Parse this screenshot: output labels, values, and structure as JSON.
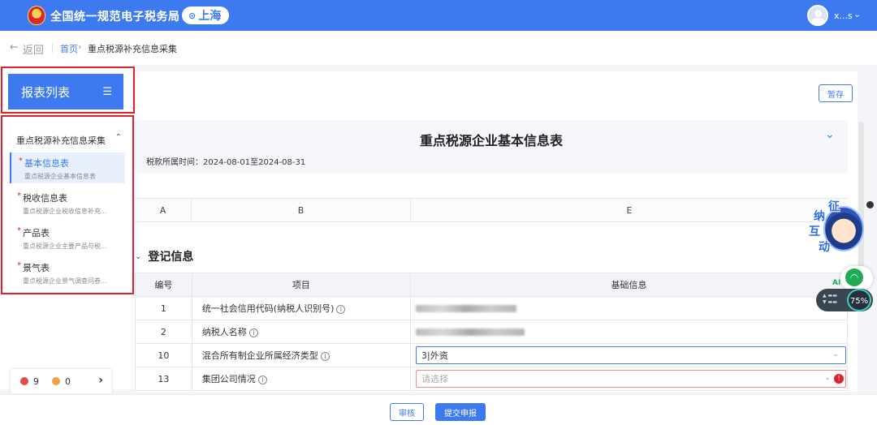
{
  "header": {
    "brand": "全国统一规范电子税务局",
    "location": "上海",
    "location_icon": "location-pin-icon",
    "username": "x...s"
  },
  "breadcrumb": {
    "back": "返回",
    "home": "首页",
    "separator": "›",
    "current": "重点税源补充信息采集"
  },
  "sidebar": {
    "list_button": "报表列表",
    "group": "重点税源补充信息采集",
    "items": [
      {
        "title": "基本信息表",
        "subtitle": "重点税源企业基本信息表",
        "required": "*",
        "active": true
      },
      {
        "title": "税收信息表",
        "subtitle": "重点税源企业税收信息补充...",
        "required": "*",
        "active": false
      },
      {
        "title": "产品表",
        "subtitle": "重点税源企业主要产品与税...",
        "required": "*",
        "active": false
      },
      {
        "title": "景气表",
        "subtitle": "重点税源企业景气调查问卷...",
        "required": "*",
        "active": false
      }
    ]
  },
  "counter": {
    "errors": "9",
    "warnings": "0"
  },
  "main": {
    "save_button": "暂存",
    "form_title": "重点税源企业基本信息表",
    "period": "税款所属时间：2024-08-01至2024-08-31",
    "col_headers": [
      "A",
      "B",
      "E"
    ],
    "section_title": "登记信息",
    "table": {
      "headers": [
        "编号",
        "项目",
        "基础信息"
      ],
      "rows": [
        {
          "num": "1",
          "item": "统一社会信用代码(纳税人识别号)"
        },
        {
          "num": "2",
          "item": "纳税人名称"
        },
        {
          "num": "10",
          "item": "混合所有制企业所属经济类型",
          "value": "3|外资"
        },
        {
          "num": "13",
          "item": "集团公司情况",
          "placeholder": "请选择"
        }
      ]
    }
  },
  "assistant": {
    "chars": [
      "征",
      "纳",
      "互",
      "动"
    ],
    "ai_label": "AI",
    "battery": "75%"
  },
  "footer": {
    "review_button": "审核",
    "submit_button": "提交申报"
  },
  "colors": {
    "primary": "#3d7af0",
    "error": "#e0202a"
  }
}
